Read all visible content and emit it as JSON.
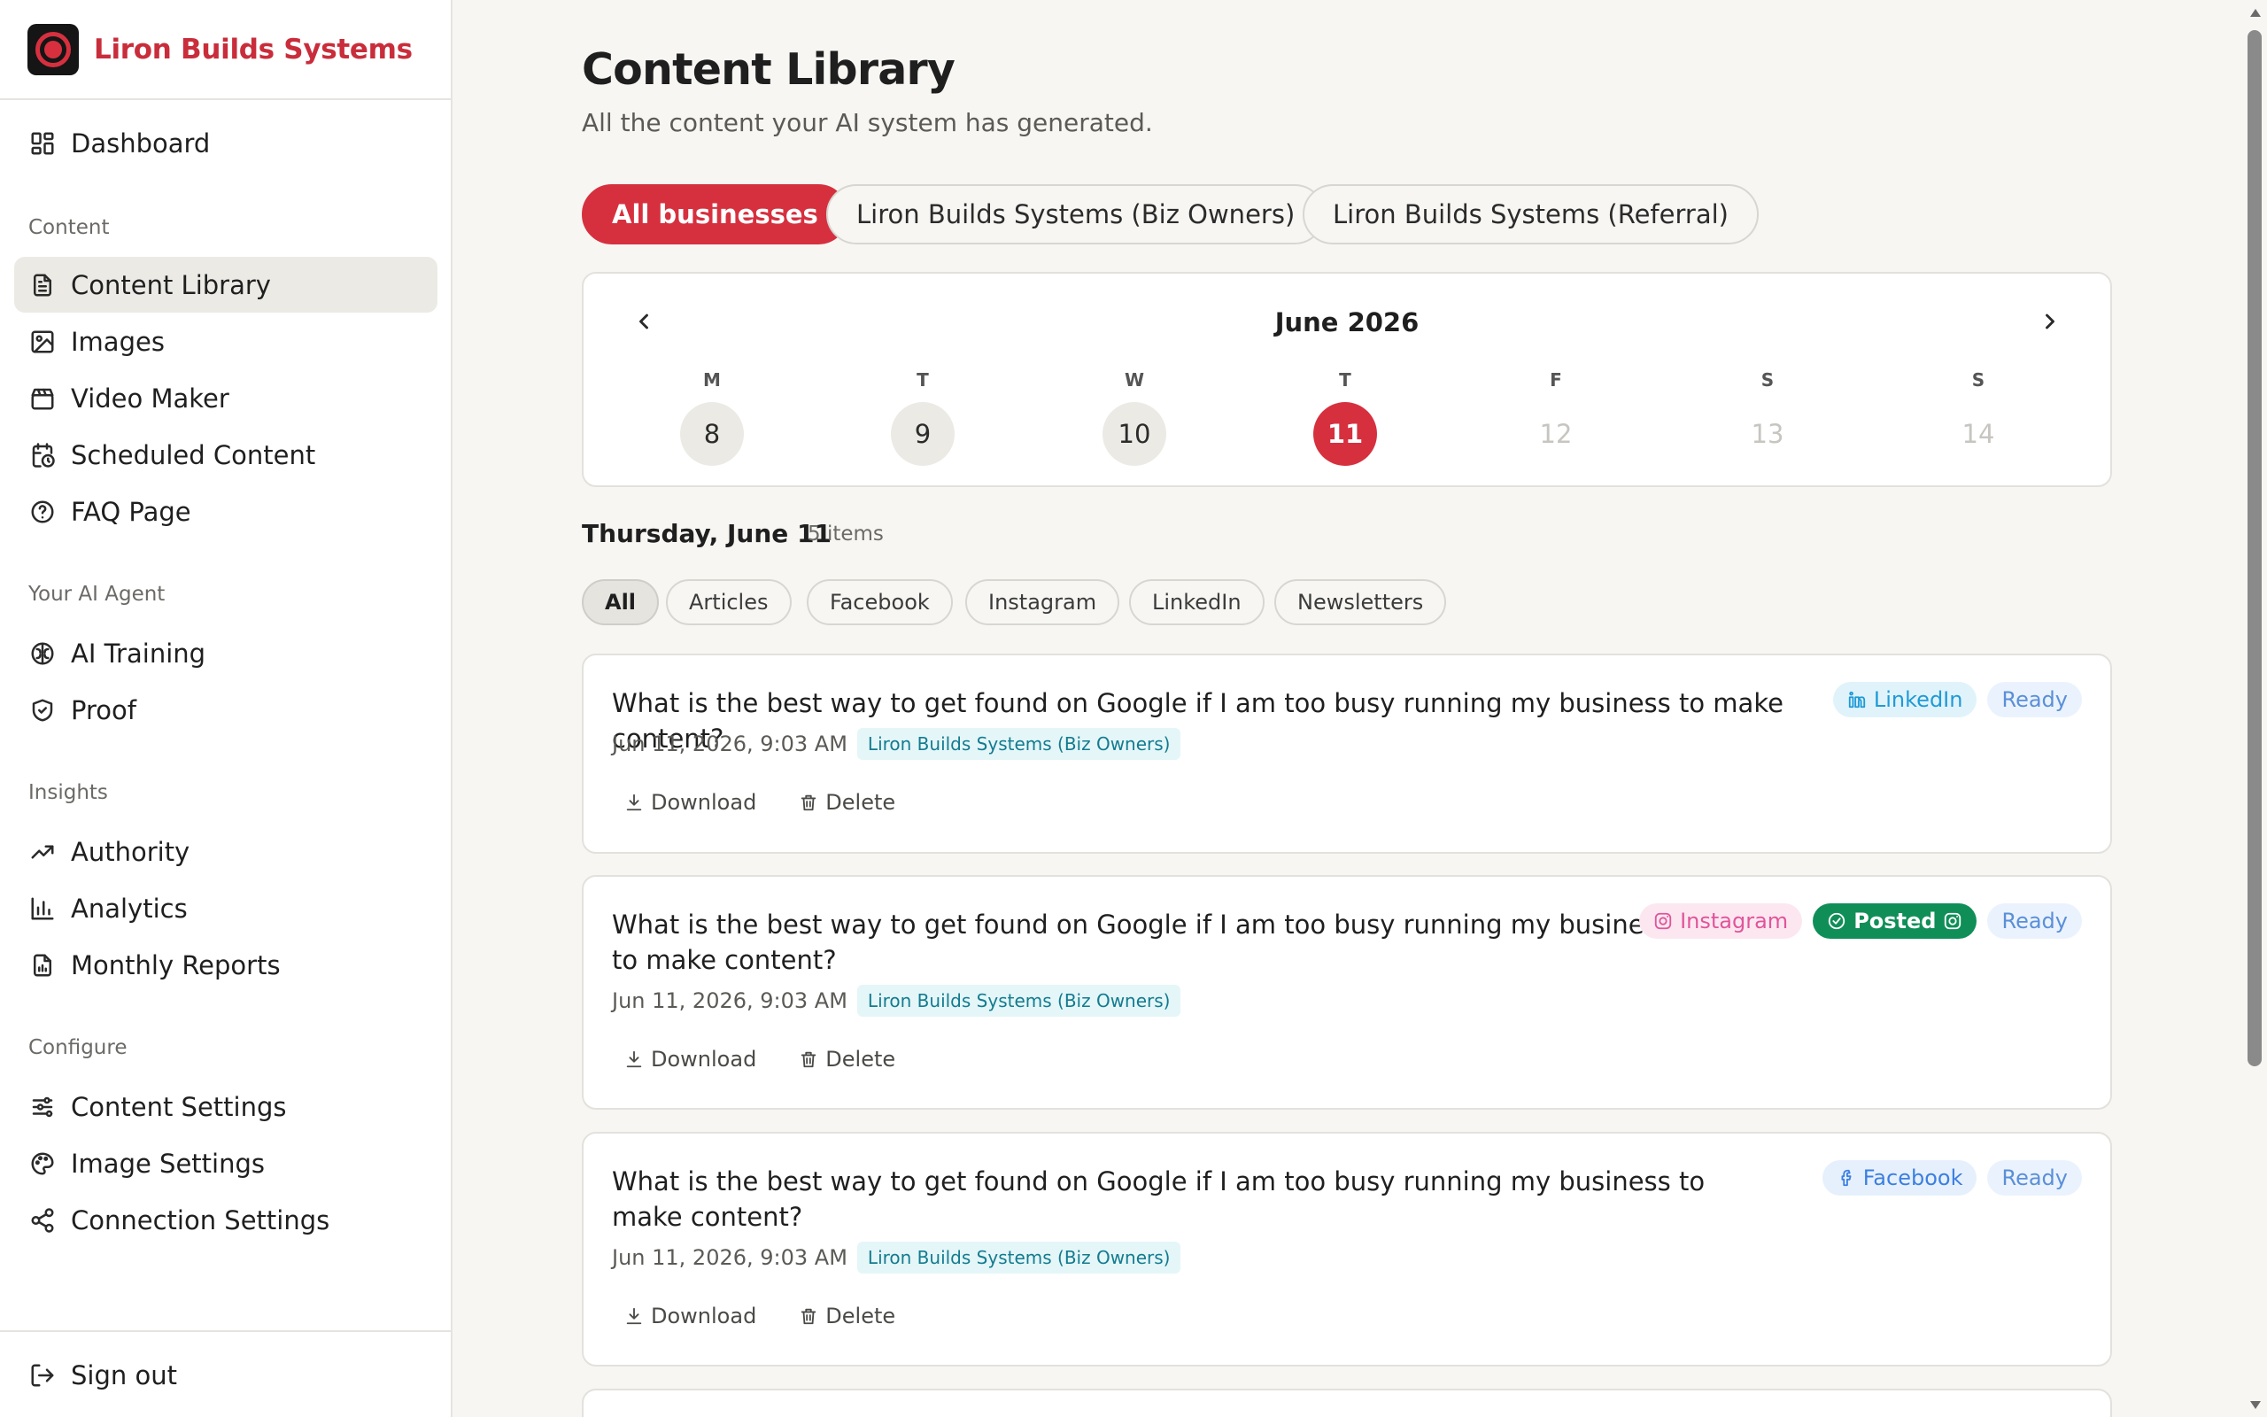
{
  "brand": {
    "name": "Liron Builds Systems"
  },
  "sidebar": {
    "top_items": [
      {
        "label": "Dashboard",
        "icon": "dashboard-icon"
      }
    ],
    "sections": [
      {
        "label": "Content",
        "items": [
          {
            "label": "Content Library",
            "icon": "file-text-icon",
            "active": true
          },
          {
            "label": "Images",
            "icon": "image-icon"
          },
          {
            "label": "Video Maker",
            "icon": "clapperboard-icon"
          },
          {
            "label": "Scheduled Content",
            "icon": "calendar-clock-icon"
          },
          {
            "label": "FAQ Page",
            "icon": "help-circle-icon"
          }
        ]
      },
      {
        "label": "Your AI Agent",
        "items": [
          {
            "label": "AI Training",
            "icon": "brain-icon"
          },
          {
            "label": "Proof",
            "icon": "shield-check-icon"
          }
        ]
      },
      {
        "label": "Insights",
        "items": [
          {
            "label": "Authority",
            "icon": "trending-up-icon"
          },
          {
            "label": "Analytics",
            "icon": "bar-chart-icon"
          },
          {
            "label": "Monthly Reports",
            "icon": "report-icon"
          }
        ]
      },
      {
        "label": "Configure",
        "items": [
          {
            "label": "Content Settings",
            "icon": "sliders-icon"
          },
          {
            "label": "Image Settings",
            "icon": "palette-icon"
          },
          {
            "label": "Connection Settings",
            "icon": "share-icon"
          }
        ]
      }
    ],
    "signout": {
      "label": "Sign out",
      "icon": "logout-icon"
    }
  },
  "page": {
    "title": "Content Library",
    "subtitle": "All the content your AI system has generated."
  },
  "business_filters": [
    {
      "label": "All businesses",
      "active": true
    },
    {
      "label": "Liron Builds Systems (Biz Owners)"
    },
    {
      "label": "Liron Builds Systems (Referral)"
    }
  ],
  "calendar": {
    "month": "June 2026",
    "days": [
      {
        "dow": "M",
        "date": "8",
        "state": "past"
      },
      {
        "dow": "T",
        "date": "9",
        "state": "past"
      },
      {
        "dow": "W",
        "date": "10",
        "state": "past"
      },
      {
        "dow": "T",
        "date": "11",
        "state": "today"
      },
      {
        "dow": "F",
        "date": "12",
        "state": "future"
      },
      {
        "dow": "S",
        "date": "13",
        "state": "future"
      },
      {
        "dow": "S",
        "date": "14",
        "state": "future"
      }
    ]
  },
  "day": {
    "heading": "Thursday, June 11",
    "count": "5 items"
  },
  "type_filters": [
    {
      "label": "All",
      "active": true
    },
    {
      "label": "Articles"
    },
    {
      "label": "Facebook"
    },
    {
      "label": "Instagram"
    },
    {
      "label": "LinkedIn"
    },
    {
      "label": "Newsletters"
    }
  ],
  "actions": {
    "download": "Download",
    "delete": "Delete"
  },
  "items": [
    {
      "title": "What is the best way to get found on Google if I am too busy running my business to make content?",
      "time": "Jun 11, 2026, 9:03 AM",
      "business": "Liron Builds Systems (Biz Owners)",
      "platform": {
        "label": "LinkedIn",
        "icon": "linkedin-icon"
      },
      "posted": null,
      "status": "Ready"
    },
    {
      "title": "What is the best way to get found on Google if I am too busy running my business to make content?",
      "time": "Jun 11, 2026, 9:03 AM",
      "business": "Liron Builds Systems (Biz Owners)",
      "platform": {
        "label": "Instagram",
        "icon": "instagram-icon"
      },
      "posted": "Posted",
      "status": "Ready"
    },
    {
      "title": "What is the best way to get found on Google if I am too busy running my business to make content?",
      "time": "Jun 11, 2026, 9:03 AM",
      "business": "Liron Builds Systems (Biz Owners)",
      "platform": {
        "label": "Facebook",
        "icon": "facebook-icon"
      },
      "posted": null,
      "status": "Ready"
    }
  ],
  "colors": {
    "accent": "#d6303f",
    "posted": "#0f8f57",
    "linkedin": "#1f9ad6",
    "instagram": "#e0559a",
    "facebook": "#3c7fe0"
  }
}
